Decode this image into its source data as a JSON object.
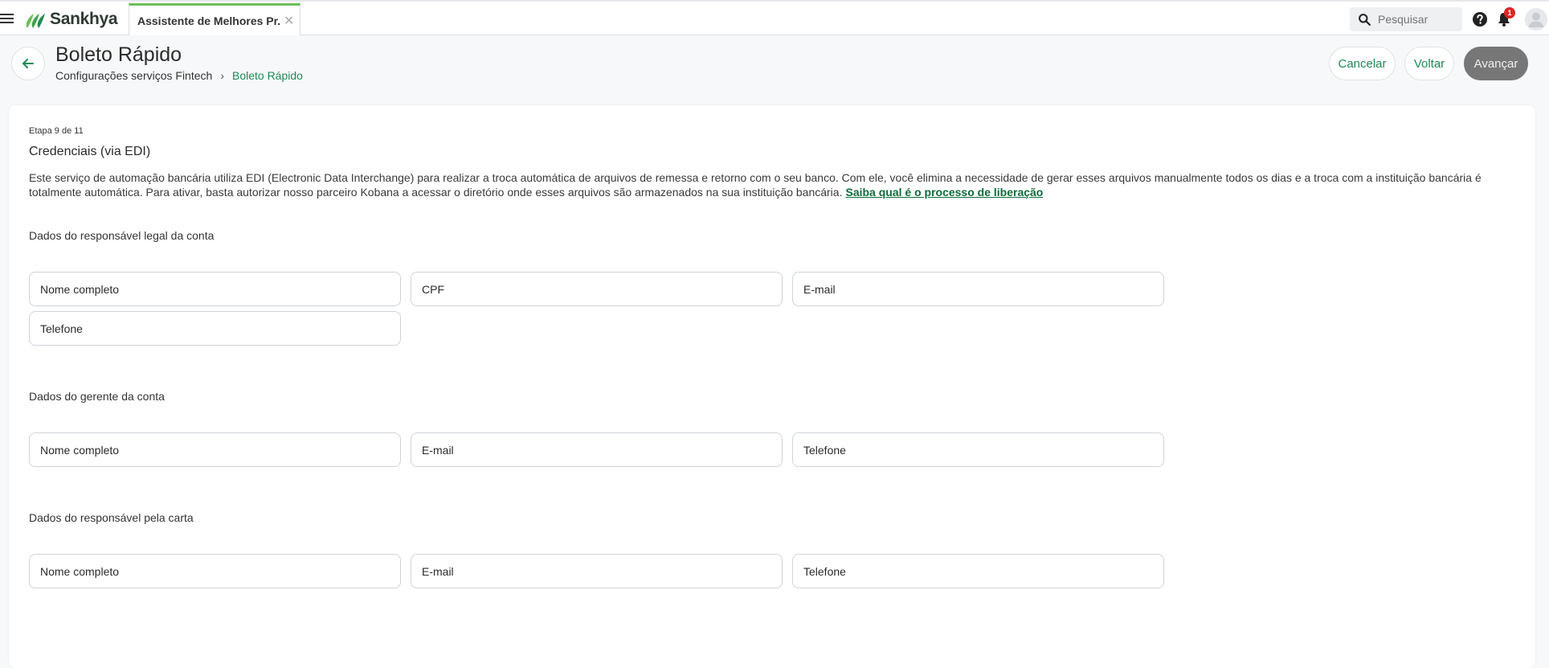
{
  "app": {
    "logo_text": "Sankhya",
    "tab_label": "Assistente de Melhores Pr...",
    "tab_close": "✕",
    "search_placeholder": "Pesquisar",
    "notification_count": "1",
    "brand_color": "#1f8a55"
  },
  "header": {
    "title": "Boleto Rápido",
    "breadcrumb": {
      "parent": "Configurações serviços Fintech",
      "separator": "›",
      "current": "Boleto Rápido"
    },
    "buttons": {
      "cancel": "Cancelar",
      "back": "Voltar",
      "next": "Avançar"
    }
  },
  "content": {
    "step": "Etapa 9 de 11",
    "title": "Credenciais (via EDI)",
    "description": "Este serviço de automação bancária utiliza EDI (Electronic Data Interchange) para realizar a troca automática de arquivos de remessa e retorno com o seu banco. Com ele, você elimina a necessidade de gerar esses arquivos manualmente todos os dias e a troca com a instituição bancária é totalmente automática. Para ativar, basta autorizar nosso parceiro Kobana a acessar o diretório onde esses arquivos são armazenados na sua instituição bancária.",
    "link": "Saiba qual é o processo de liberação",
    "groups": [
      {
        "label": "Dados do responsável legal da conta",
        "fields": [
          {
            "placeholder": "Nome completo",
            "value": ""
          },
          {
            "placeholder": "CPF",
            "value": ""
          },
          {
            "placeholder": "E-mail",
            "value": ""
          },
          {
            "placeholder": "Telefone",
            "value": ""
          }
        ]
      },
      {
        "label": "Dados do gerente da conta",
        "fields": [
          {
            "placeholder": "Nome completo",
            "value": ""
          },
          {
            "placeholder": "E-mail",
            "value": ""
          },
          {
            "placeholder": "Telefone",
            "value": ""
          }
        ]
      },
      {
        "label": "Dados do responsável pela carta",
        "fields": [
          {
            "placeholder": "Nome completo",
            "value": ""
          },
          {
            "placeholder": "E-mail",
            "value": ""
          },
          {
            "placeholder": "Telefone",
            "value": ""
          }
        ]
      }
    ]
  }
}
